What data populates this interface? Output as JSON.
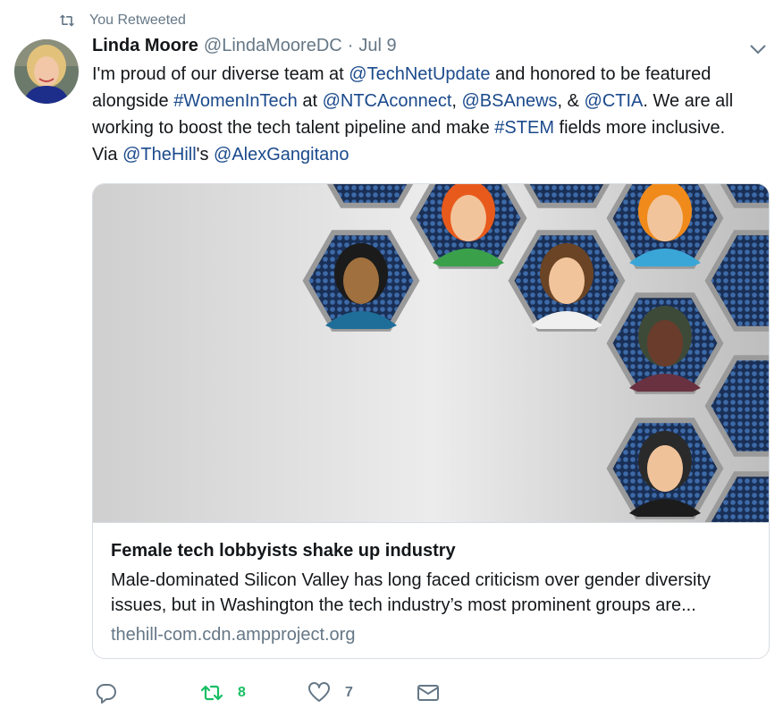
{
  "retweet_context": {
    "icon": "retweet-icon",
    "text": "You Retweeted"
  },
  "tweet": {
    "author_name": "Linda Moore",
    "author_handle": "@LindaMooreDC",
    "separator": "·",
    "date": "Jul 9",
    "text_lines": [
      [
        {
          "t": "I'm proud of our diverse team at "
        },
        {
          "t": "@TechNetUpdate",
          "k": "mention"
        },
        {
          "t": " and honored to be featured"
        }
      ],
      [
        {
          "t": "alongside "
        },
        {
          "t": "#WomenInTech",
          "k": "hashtag"
        },
        {
          "t": " at "
        },
        {
          "t": "@NTCAconnect",
          "k": "mention"
        },
        {
          "t": ", "
        },
        {
          "t": "@BSAnews",
          "k": "mention"
        },
        {
          "t": ", & "
        },
        {
          "t": "@CTIA",
          "k": "mention"
        },
        {
          "t": ". We are all"
        }
      ],
      [
        {
          "t": "working to boost the tech talent pipeline and make "
        },
        {
          "t": "#STEM",
          "k": "hashtag"
        },
        {
          "t": " fields more inclusive."
        }
      ],
      [
        {
          "t": "Via "
        },
        {
          "t": "@TheHill",
          "k": "mention"
        },
        {
          "t": "'s "
        },
        {
          "t": "@AlexGangitano",
          "k": "mention"
        }
      ]
    ]
  },
  "card": {
    "title": "Female tech lobbyists shake up industry",
    "description_lines": [
      "Male-dominated Silicon Valley has long faced criticism over gender diversity",
      "issues, but in Washington the tech industry’s most prominent groups are..."
    ],
    "url": "thehill-com.cdn.ampproject.org"
  },
  "actions": {
    "reply": {
      "icon": "reply-icon",
      "count": ""
    },
    "retweet": {
      "icon": "retweet-icon",
      "count": "8",
      "active": true,
      "color": "#17bf63"
    },
    "like": {
      "icon": "heart-icon",
      "count": "7"
    },
    "dm": {
      "icon": "envelope-icon"
    }
  },
  "colors": {
    "link": "#1b4a8c",
    "secondary": "#657786",
    "retweet_active": "#17bf63",
    "border": "#d7dde3"
  }
}
